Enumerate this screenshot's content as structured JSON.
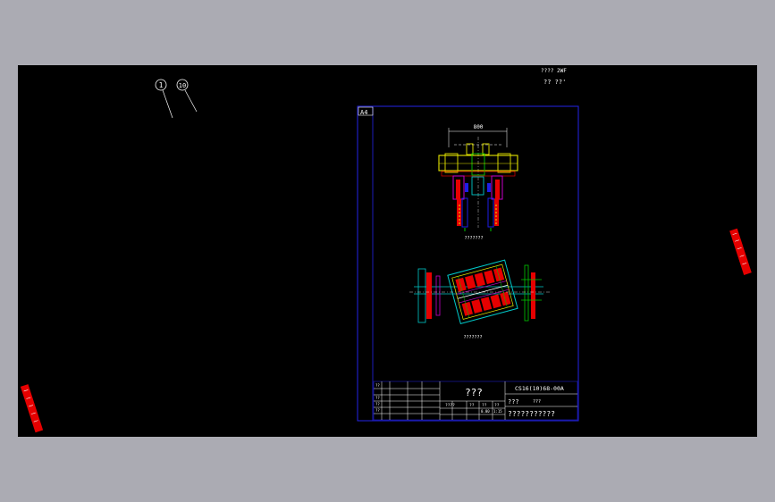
{
  "drawing": {
    "sheet_size": "A4",
    "balloons": [
      "1",
      "10"
    ],
    "corner_note_1": "???? 2WF",
    "corner_note_2": "?? ??'",
    "top_view_dimension": "800",
    "top_view_label": "???????",
    "bottom_view_label": "???????",
    "title_block": {
      "drawing_title": "???",
      "drawing_number": "CS16(10)68-00A",
      "material": "???",
      "material_code": "???",
      "company": "???????????",
      "grid_headers": [
        "????",
        "??",
        "??",
        "??"
      ],
      "scale": "1:15",
      "weight": "0.00",
      "row_labels": [
        "??",
        "??",
        "??",
        "??"
      ]
    },
    "colors": {
      "model_background": "#000000",
      "app_background": "#ababb3",
      "frame": "#1e1ee6",
      "yellow": "#e6e600",
      "red": "#e60000",
      "cyan": "#00c8c8",
      "magenta": "#c800c8",
      "green": "#00c800"
    }
  }
}
